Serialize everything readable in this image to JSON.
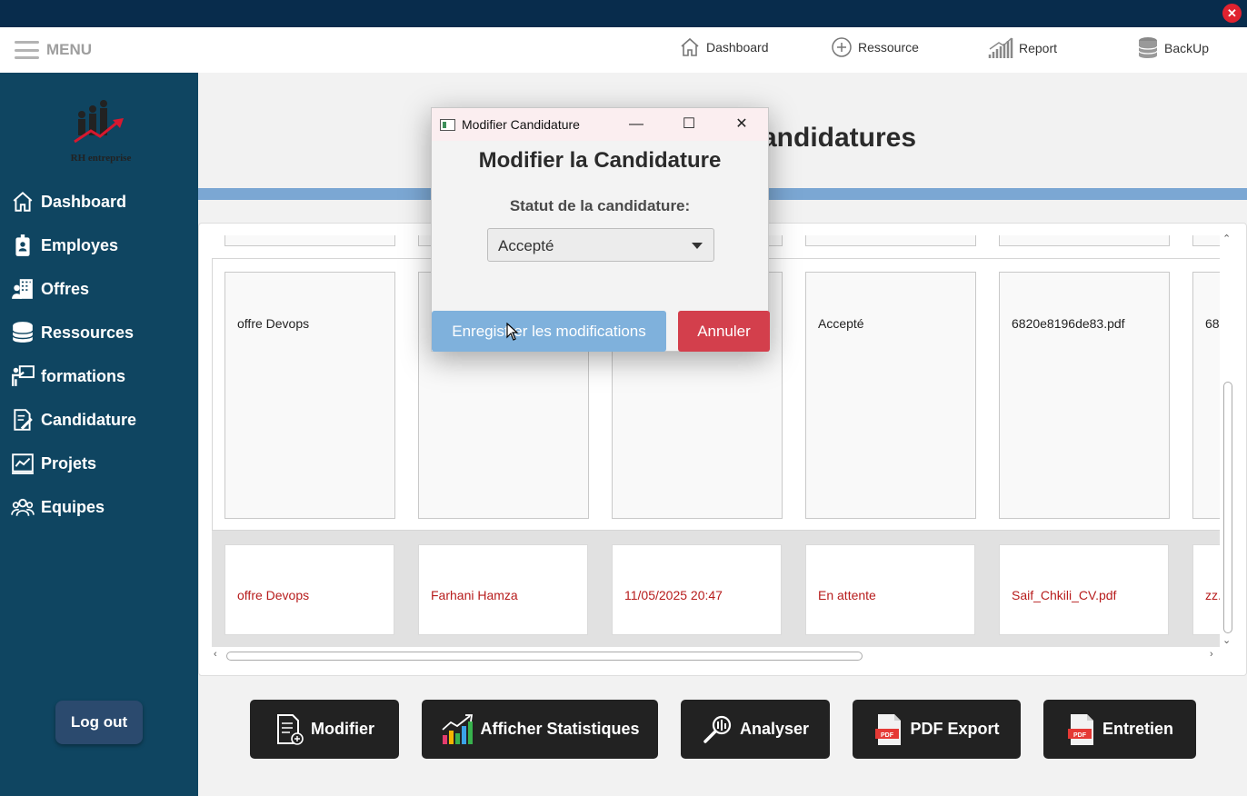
{
  "topnav": {
    "menu_label": "MENU",
    "items": [
      {
        "label": "Dashboard",
        "icon": "home-icon"
      },
      {
        "label": "Ressource",
        "icon": "plus-circle-icon"
      },
      {
        "label": "Report",
        "icon": "bar-chart-icon"
      },
      {
        "label": "BackUp",
        "icon": "database-icon"
      }
    ]
  },
  "sidebar": {
    "logo_text": "RH entreprise",
    "items": [
      {
        "label": "Dashboard",
        "icon": "home-icon"
      },
      {
        "label": "Employes",
        "icon": "badge-icon"
      },
      {
        "label": "Offres",
        "icon": "building-user-icon"
      },
      {
        "label": "Ressources",
        "icon": "database-icon"
      },
      {
        "label": "formations",
        "icon": "presentation-icon"
      },
      {
        "label": "Candidature",
        "icon": "document-edit-icon"
      },
      {
        "label": "Projets",
        "icon": "chart-board-icon"
      },
      {
        "label": "Equipes",
        "icon": "team-icon"
      }
    ],
    "logout_label": "Log out"
  },
  "main": {
    "title_suffix": "andidatures",
    "row_a": [
      "offre  Devops",
      "",
      "",
      "Accepté",
      "6820e8196de83.pdf",
      "68"
    ],
    "row_b": [
      "offre  Devops",
      "Farhani Hamza",
      "11/05/2025 20:47",
      "En attente",
      "Saif_Chkili_CV.pdf",
      "zz."
    ]
  },
  "actions": [
    {
      "label": "Modifier",
      "icon": "document-edit-icon"
    },
    {
      "label": "Afficher Statistiques",
      "icon": "growth-chart-icon"
    },
    {
      "label": "Analyser",
      "icon": "magnifier-icon"
    },
    {
      "label": "PDF Export",
      "icon": "pdf-icon"
    },
    {
      "label": "Entretien",
      "icon": "pdf-icon"
    }
  ],
  "dialog": {
    "window_title": "Modifier Candidature",
    "heading": "Modifier la Candidature",
    "status_label": "Statut de la candidature:",
    "status_value": "Accepté",
    "save_label": "Enregistrer les modifications",
    "cancel_label": "Annuler"
  },
  "colors": {
    "sidebar": "#0f4561",
    "titlebar": "#082c4c",
    "accent_blue": "#7ba7d3",
    "cancel_red": "#d33f4c",
    "save_blue": "#7fb1dc",
    "pending_text": "#b71c1c"
  }
}
